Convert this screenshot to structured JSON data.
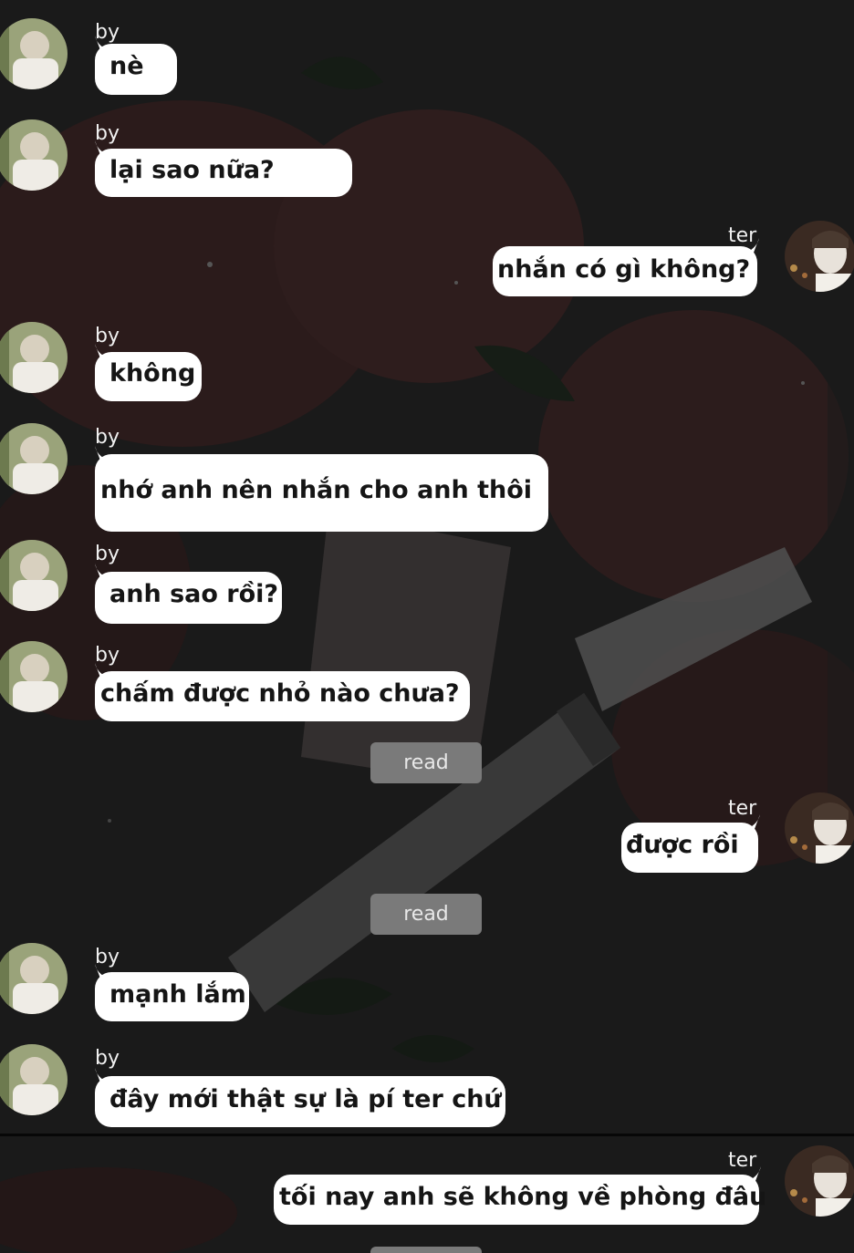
{
  "chat": {
    "messages": [
      {
        "sender": "by",
        "side": "left",
        "text": "nè"
      },
      {
        "sender": "by",
        "side": "left",
        "text": "lại sao nữa?"
      },
      {
        "sender": "ter",
        "side": "right",
        "text": "nhắn có gì không?"
      },
      {
        "sender": "by",
        "side": "left",
        "text": "không"
      },
      {
        "sender": "by",
        "side": "left",
        "text": "nhớ anh nên nhắn cho anh thôi"
      },
      {
        "sender": "by",
        "side": "left",
        "text": "anh sao rồi?"
      },
      {
        "sender": "by",
        "side": "left",
        "text": "chấm được nhỏ nào chưa?"
      },
      {
        "status": "read"
      },
      {
        "sender": "ter",
        "side": "right",
        "text": "được rồi"
      },
      {
        "status": "read"
      },
      {
        "sender": "by",
        "side": "left",
        "text": "mạnh lắm"
      },
      {
        "sender": "by",
        "side": "left",
        "text": "đây mới thật sự là pí ter chứ"
      },
      {
        "sender": "ter",
        "side": "right",
        "text": "tối nay anh sẽ không về phòng đâu"
      }
    ]
  },
  "colors": {
    "bubble": "#ffffff",
    "bubble_text": "#151515",
    "read_pill": "#7a7a7a",
    "background": "#171717"
  },
  "icons": {
    "by_avatar": "avatar-by",
    "ter_avatar": "avatar-ter"
  }
}
